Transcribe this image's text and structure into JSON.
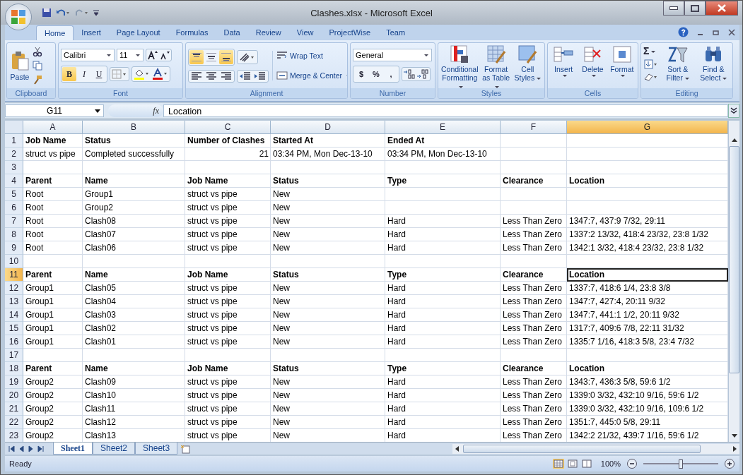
{
  "window": {
    "title": "Clashes.xlsx - Microsoft Excel"
  },
  "ribbon_tabs": [
    {
      "label": "Home",
      "selected": true
    },
    {
      "label": "Insert",
      "selected": false
    },
    {
      "label": "Page Layout",
      "selected": false
    },
    {
      "label": "Formulas",
      "selected": false
    },
    {
      "label": "Data",
      "selected": false
    },
    {
      "label": "Review",
      "selected": false
    },
    {
      "label": "View",
      "selected": false
    },
    {
      "label": "ProjectWise",
      "selected": false
    },
    {
      "label": "Team",
      "selected": false
    }
  ],
  "clipboard": {
    "paste": "Paste",
    "group": "Clipboard"
  },
  "font": {
    "name": "Calibri",
    "size": "11",
    "group": "Font",
    "styles": [
      {
        "label": "B",
        "on": true
      },
      {
        "label": "I",
        "on": false
      },
      {
        "label": "U",
        "on": false
      }
    ]
  },
  "alignment": {
    "group": "Alignment",
    "vertical": [
      {
        "on": true
      },
      {
        "on": false
      },
      {
        "on": true
      }
    ],
    "wrap": "Wrap Text",
    "merge": "Merge & Center"
  },
  "number": {
    "format": "General",
    "group": "Number",
    "symbols": [
      "$",
      "%",
      ","
    ]
  },
  "styles": {
    "group": "Styles",
    "buttons": [
      {
        "label": "Conditional Formatting",
        "kind": "conditional"
      },
      {
        "label": "Format as Table",
        "kind": "table"
      },
      {
        "label": "Cell Styles",
        "kind": "cellstyles"
      }
    ]
  },
  "cells": {
    "group": "Cells",
    "buttons": [
      {
        "label": "Insert",
        "kind": "insert"
      },
      {
        "label": "Delete",
        "kind": "delete"
      },
      {
        "label": "Format",
        "kind": "format"
      }
    ]
  },
  "editing": {
    "group": "Editing",
    "sigma": "Σ",
    "buttons": [
      {
        "label": "Sort & Filter",
        "kind": "sort"
      },
      {
        "label": "Find & Select",
        "kind": "find"
      }
    ]
  },
  "formula_bar": {
    "name_box": "G11",
    "fx": "fx",
    "value": "Location"
  },
  "columns": [
    {
      "label": "A",
      "selected": false
    },
    {
      "label": "B",
      "selected": false
    },
    {
      "label": "C",
      "selected": false
    },
    {
      "label": "D",
      "selected": false
    },
    {
      "label": "E",
      "selected": false
    },
    {
      "label": "F",
      "selected": false
    },
    {
      "label": "G",
      "selected": true
    }
  ],
  "rows": [
    {
      "number": "1",
      "selected": false,
      "kind": "header",
      "cells": [
        "Job Name",
        "Status",
        "Number of Clashes",
        "Started At",
        "Ended At",
        null,
        null
      ]
    },
    {
      "number": "2",
      "selected": false,
      "kind": "data",
      "cells": [
        "struct vs pipe",
        "Completed successfully",
        {
          "text": "21",
          "kind": "number"
        },
        " 03:34 PM, Mon Dec-13-10",
        " 03:34 PM, Mon Dec-13-10",
        null,
        null
      ]
    },
    {
      "number": "3",
      "selected": false,
      "kind": "data"
    },
    {
      "number": "4",
      "selected": false,
      "kind": "header",
      "cells": [
        "Parent",
        "Name",
        "Job Name",
        "Status",
        "Type",
        "Clearance",
        "Location"
      ]
    },
    {
      "number": "5",
      "selected": false,
      "kind": "data",
      "cells": [
        "Root",
        "Group1",
        "struct vs pipe",
        "New",
        null,
        null,
        null
      ]
    },
    {
      "number": "6",
      "selected": false,
      "kind": "data",
      "cells": [
        "Root",
        "Group2",
        "struct vs pipe",
        "New",
        null,
        null,
        null
      ]
    },
    {
      "number": "7",
      "selected": false,
      "kind": "data",
      "cells": [
        "Root",
        "Clash08",
        "struct vs pipe",
        "New",
        "Hard",
        "Less Than Zero",
        "1347:7, 437:9 7/32, 29:11"
      ]
    },
    {
      "number": "8",
      "selected": false,
      "kind": "data",
      "cells": [
        "Root",
        "Clash07",
        "struct vs pipe",
        "New",
        "Hard",
        "Less Than Zero",
        "1337:2 13/32, 418:4 23/32, 23:8 1/32"
      ]
    },
    {
      "number": "9",
      "selected": false,
      "kind": "data",
      "cells": [
        "Root",
        "Clash06",
        "struct vs pipe",
        "New",
        "Hard",
        "Less Than Zero",
        "1342:1 3/32, 418:4 23/32, 23:8 1/32"
      ]
    },
    {
      "number": "10",
      "selected": false,
      "kind": "data"
    },
    {
      "number": "11",
      "selected": true,
      "kind": "header",
      "cells": [
        "Parent",
        "Name",
        "Job Name",
        "Status",
        "Type",
        "Clearance",
        {
          "text": "Location",
          "selected": true
        }
      ]
    },
    {
      "number": "12",
      "selected": false,
      "kind": "data",
      "cells": [
        "Group1",
        "Clash05",
        "struct vs pipe",
        "New",
        "Hard",
        "Less Than Zero",
        "1337:7, 418:6 1/4, 23:8 3/8"
      ]
    },
    {
      "number": "13",
      "selected": false,
      "kind": "data",
      "cells": [
        "Group1",
        "Clash04",
        "struct vs pipe",
        "New",
        "Hard",
        "Less Than Zero",
        "1347:7, 427:4, 20:11 9/32"
      ]
    },
    {
      "number": "14",
      "selected": false,
      "kind": "data",
      "cells": [
        "Group1",
        "Clash03",
        "struct vs pipe",
        "New",
        "Hard",
        "Less Than Zero",
        "1347:7, 441:1 1/2, 20:11 9/32"
      ]
    },
    {
      "number": "15",
      "selected": false,
      "kind": "data",
      "cells": [
        "Group1",
        "Clash02",
        "struct vs pipe",
        "New",
        "Hard",
        "Less Than Zero",
        "1317:7, 409:6 7/8, 22:11 31/32"
      ]
    },
    {
      "number": "16",
      "selected": false,
      "kind": "data",
      "cells": [
        "Group1",
        "Clash01",
        "struct vs pipe",
        "New",
        "Hard",
        "Less Than Zero",
        "1335:7 1/16, 418:3 5/8, 23:4 7/32"
      ]
    },
    {
      "number": "17",
      "selected": false,
      "kind": "data"
    },
    {
      "number": "18",
      "selected": false,
      "kind": "header",
      "cells": [
        "Parent",
        "Name",
        "Job Name",
        "Status",
        "Type",
        "Clearance",
        "Location"
      ]
    },
    {
      "number": "19",
      "selected": false,
      "kind": "data",
      "cells": [
        "Group2",
        "Clash09",
        "struct vs pipe",
        "New",
        "Hard",
        "Less Than Zero",
        "1343:7, 436:3 5/8, 59:6 1/2"
      ]
    },
    {
      "number": "20",
      "selected": false,
      "kind": "data",
      "cells": [
        "Group2",
        "Clash10",
        "struct vs pipe",
        "New",
        "Hard",
        "Less Than Zero",
        "1339:0 3/32, 432:10 9/16, 59:6 1/2"
      ]
    },
    {
      "number": "21",
      "selected": false,
      "kind": "data",
      "cells": [
        "Group2",
        "Clash11",
        "struct vs pipe",
        "New",
        "Hard",
        "Less Than Zero",
        "1339:0 3/32, 432:10 9/16, 109:6 1/2"
      ]
    },
    {
      "number": "22",
      "selected": false,
      "kind": "data",
      "cells": [
        "Group2",
        "Clash12",
        "struct vs pipe",
        "New",
        "Hard",
        "Less Than Zero",
        "1351:7, 445:0 5/8, 29:11"
      ]
    },
    {
      "number": "23",
      "selected": false,
      "kind": "data",
      "cells": [
        "Group2",
        "Clash13",
        "struct vs pipe",
        "New",
        "Hard",
        "Less Than Zero",
        "1342:2 21/32, 439:7 1/16, 59:6 1/2"
      ]
    }
  ],
  "sheet_tabs": [
    {
      "label": "Sheet1",
      "selected": true
    },
    {
      "label": "Sheet2",
      "selected": false
    },
    {
      "label": "Sheet3",
      "selected": false
    }
  ],
  "status_bar": {
    "status": "Ready",
    "zoom": "100%",
    "zoom_level": {
      "level": 0.5
    }
  }
}
